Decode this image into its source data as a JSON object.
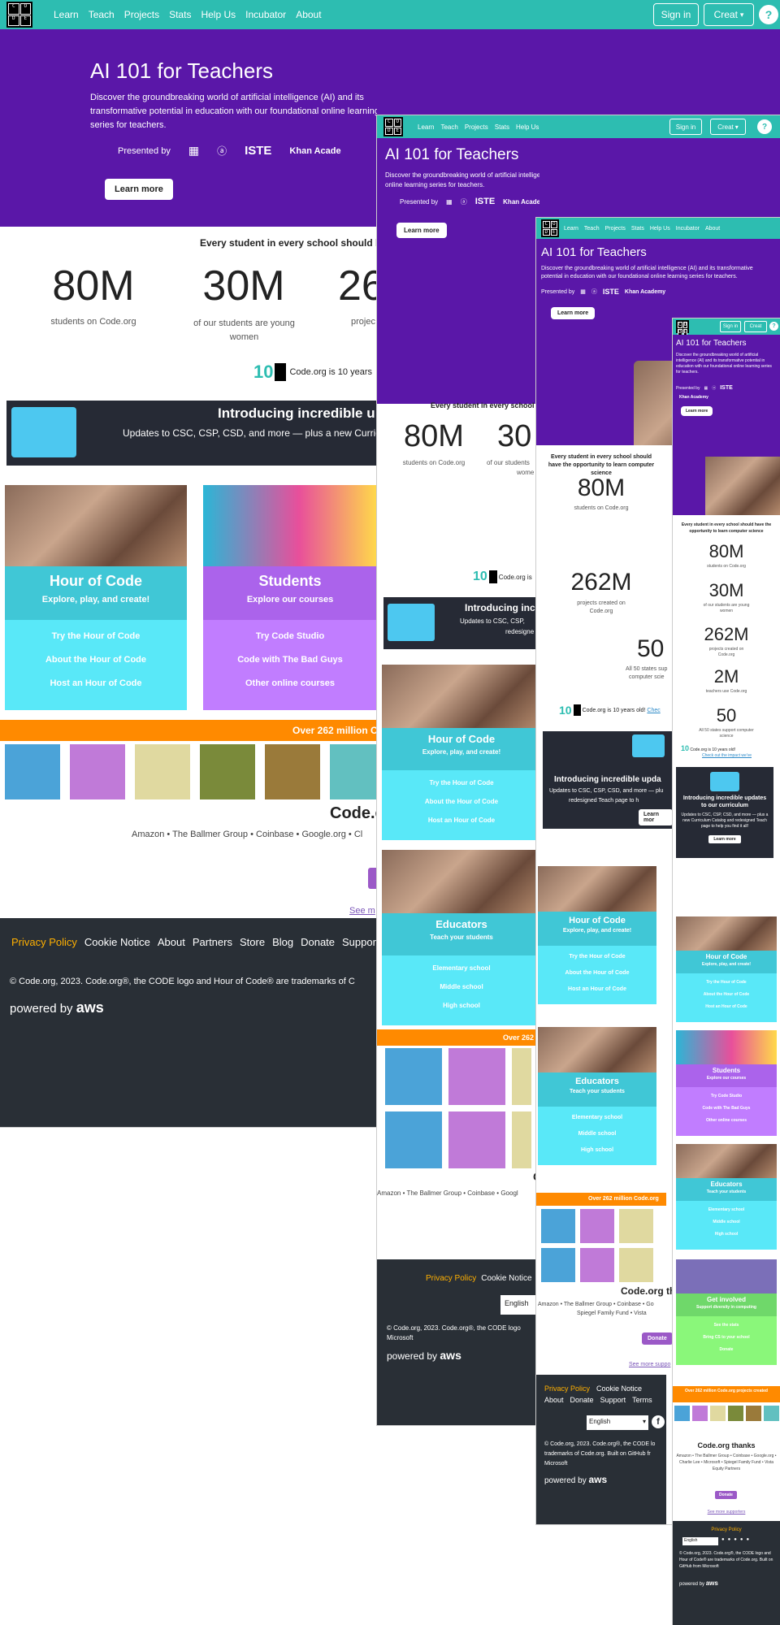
{
  "logo_letters": [
    "C",
    "O",
    "D",
    "E"
  ],
  "nav": {
    "links": [
      "Learn",
      "Teach",
      "Projects",
      "Stats",
      "Help Us",
      "Incubator",
      "About"
    ],
    "signin": "Sign in",
    "create": "Creat",
    "help": "?"
  },
  "hero": {
    "title": "AI 101 for Teachers",
    "desc": "Discover the groundbreaking world of artificial intelligence (AI) and its transformative potential in education with our foundational online learning series for teachers.",
    "presented_by": "Presented by",
    "partner_iste": "ISTE",
    "partner_khan": "Khan Academy",
    "partner_khan_cut": "Khan Acade",
    "learn_more": "Learn more"
  },
  "stats": {
    "heading": "Every student in every school should have the opportunity to learn computer science",
    "heading_cut": "Every student in every school should h",
    "heading_cut2": "Every student in every school sh",
    "heading_cut3": "Every student in every school should have the opportunity to learn computer science",
    "items": [
      {
        "num": "80M",
        "label": "students on Code.org"
      },
      {
        "num": "30M",
        "label": "of our students are young women"
      },
      {
        "num": "262M",
        "label": "projects created on Code.org"
      },
      {
        "num": "2M",
        "label": "teachers use Code.org"
      },
      {
        "num": "50",
        "label": "All 50 states support computer science"
      }
    ],
    "num_cut": "26",
    "lbl_cut": "projec",
    "num_cut2": "30",
    "lbl_cut2": "of our students",
    "lbl_cut2b": "wome",
    "ten": "Code.org is 10 years old!",
    "ten_cut": "Code.org is 10 years",
    "ten_cut2": "Code.org is",
    "check": "Check out the impact we've",
    "check_cut": "Chec",
    "ten_logo": "10",
    "sup": "All 50 states sup",
    "sup2": "computer scie"
  },
  "curriculum": {
    "title": "Introducing incredible updates to our curriculum",
    "title_cut": "Introducing incredible u",
    "title_cut2": "Introducing incr",
    "title_cut3": "Introducing incredible upda",
    "desc": "Updates to CSC, CSP, CSD, and more — plus a new Curriculum Catalog and redesigned Teach page to help you find it all!",
    "desc_cut": "Updates to CSC, CSP, CSD, and more — plus a new Curricult",
    "desc_cut2": "Updates to CSC, CSP,",
    "desc_cut2b": "redesigne",
    "desc_cut3": "Updates to CSC, CSP, CSD, and more — plu",
    "desc_cut3b": "redesigned Teach page to h",
    "learn_more": "Learn more",
    "learn_more_cut": "Learn mor"
  },
  "cards": [
    {
      "title": "Hour of Code",
      "sub": "Explore, play, and create!",
      "links": [
        "Try the Hour of Code",
        "About the Hour of Code",
        "Host an Hour of Code"
      ]
    },
    {
      "title": "Students",
      "sub": "Explore our courses",
      "links": [
        "Try Code Studio",
        "Code with The Bad Guys",
        "Other online courses"
      ]
    },
    {
      "title": "Educators",
      "sub": "Teach your students",
      "links": [
        "Elementary school",
        "Middle school",
        "High school"
      ]
    },
    {
      "title": "Get involved",
      "sub": "Support diversity in computing",
      "links": [
        "See the stats",
        "Bring CS to your school",
        "Donate"
      ]
    }
  ],
  "projects": {
    "banner": "Over 262 million Code.org projects created",
    "banner_cut": "Over 262 million C",
    "banner_cut2": "Over 262",
    "banner_cut3": "Over 262 million Code.org"
  },
  "thanks": {
    "title": "Code.org thanks",
    "title_cut": "Code.c",
    "title_cut2": "C",
    "title_cut3": "Code.org th",
    "sponsors": "Amazon • The Ballmer Group • Coinbase • Google.org • Charlie Lee • Microsoft • Spiegel Family Fund • Vista Equity Partners",
    "sponsors_cut": "Amazon • The Ballmer Group • Coinbase • Google.org • Cl",
    "sponsors_cut2": "Amazon • The Ballmer Group • Coinbase • Googl",
    "sponsors_cut3a": "Amazon • The Ballmer Group • Coinbase • Go",
    "sponsors_cut3b": "Spiegel Family Fund • Vista",
    "donate": "Donate",
    "see_more": "See more supporters",
    "see_more_cut": "See m",
    "see_more_cut2": "See more suppo"
  },
  "footer": {
    "links": [
      "Privacy Policy",
      "Cookie Notice",
      "About",
      "Partners",
      "Store",
      "Blog",
      "Donate",
      "Support",
      "Terms"
    ],
    "language": "English",
    "copyright": "© Code.org, 2023. Code.org®, the CODE logo and Hour of Code® are trademarks of Code.org. Built on GitHub from Microsoft",
    "copyright_cut": "© Code.org, 2023. Code.org®, the CODE logo and Hour of Code® are trademarks of C",
    "copyright_cut2": "© Code.org, 2023. Code.org®, the CODE logo",
    "copyright_cut2b": "Microsoft",
    "copyright_cut3a": "© Code.org, 2023. Code.org®, the CODE lo",
    "copyright_cut3b": "trademarks of Code.org. Built on GitHub fr",
    "copyright_cut3c": "Microsoft",
    "powered": "powered by",
    "aws": "aws"
  }
}
